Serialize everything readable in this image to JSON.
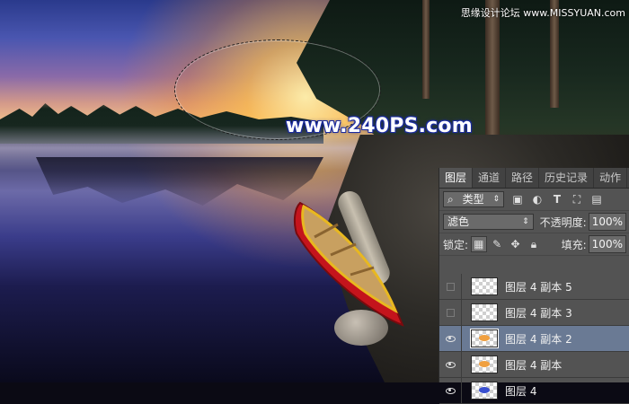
{
  "watermark": {
    "site": "www.240PS.com",
    "corner": "思缘设计论坛 www.MISSYUAN.com"
  },
  "panel": {
    "tabs": [
      "图层",
      "通道",
      "路径",
      "历史记录",
      "动作"
    ],
    "filter": {
      "label": "类型",
      "icons": [
        "image-filter-icon",
        "adjustment-filter-icon",
        "type-filter-icon",
        "shape-filter-icon",
        "smart-object-filter-icon"
      ]
    },
    "blend_mode": "滤色",
    "opacity_label": "不透明度:",
    "opacity_value": "100%",
    "lock_label": "锁定:",
    "fill_label": "填充:",
    "fill_value": "100%",
    "layers": [
      {
        "name": "图层 4 副本 5",
        "visible": false,
        "selected": false,
        "thumb_color": ""
      },
      {
        "name": "图层 4 副本 3",
        "visible": false,
        "selected": false,
        "thumb_color": ""
      },
      {
        "name": "图层 4 副本 2",
        "visible": true,
        "selected": true,
        "thumb_color": "#f0a040"
      },
      {
        "name": "图层 4 副本",
        "visible": true,
        "selected": false,
        "thumb_color": "#f0a040"
      },
      {
        "name": "图层 4",
        "visible": true,
        "selected": false,
        "thumb_color": "#3a50d0"
      }
    ]
  },
  "colors": {
    "panel_bg": "#535353",
    "selected_row": "#6a7a94",
    "watermark_outline": "#1a2aa0"
  }
}
